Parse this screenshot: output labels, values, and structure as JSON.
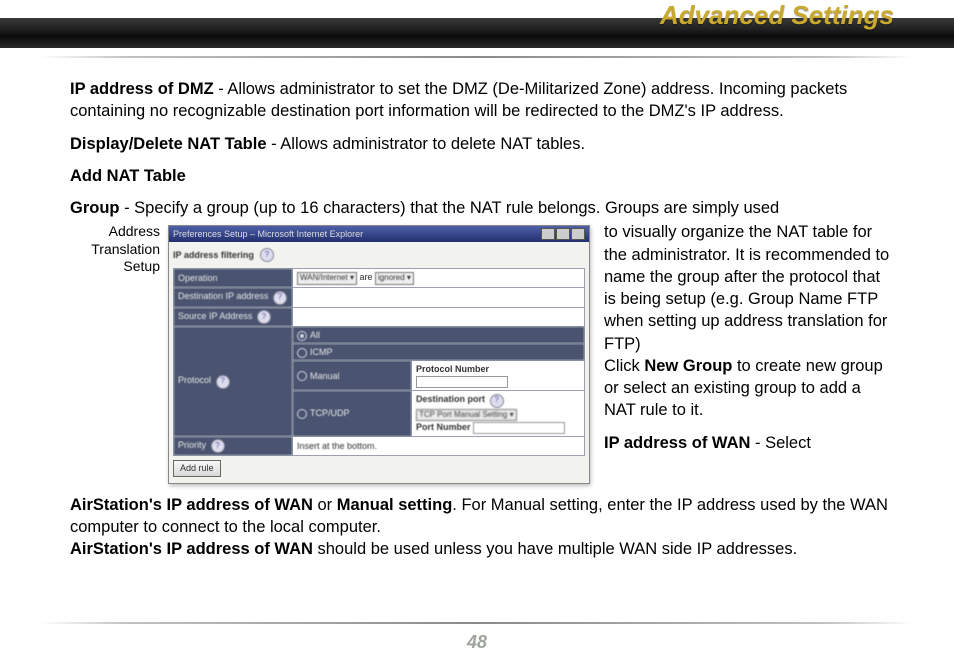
{
  "header": {
    "title": "Advanced Settings"
  },
  "pagenum": "48",
  "para": {
    "dmz_label": "IP address of DMZ",
    "dmz_text": " - Allows administrator to set the DMZ (De-Militarized Zone) address. Incoming packets containing no recognizable destination port information will be redirected to the DMZ's IP address.",
    "nat_del_label": "Display/Delete NAT Table",
    "nat_del_text": "  - Allows administrator to delete NAT tables.",
    "add_nat_label": "Add NAT Table",
    "group_label": "Group",
    "group_lead_text": " - Specify a group (up to 16 characters) that the NAT rule belongs.   Groups are simply used ",
    "group_wrap_text_1": "to visually organize the NAT table for the administrator.  It is recommended to name the group after the protocol that is being setup (e.g. Group Name FTP when setting up address translation for FTP)",
    "group_wrap_click": "Click ",
    "group_wrap_newgroup": "New Group",
    "group_wrap_text_2": " to create new group or select an existing group to add a NAT rule to it.",
    "wan_label": "IP address of WAN",
    "wan_tail": " - Select ",
    "wan_para_1a": "AirStation's IP address of WAN",
    "wan_para_1b": " or ",
    "wan_para_1c": "Manual setting",
    "wan_para_1d": ".  For Manual setting, enter the IP address used by the WAN computer to connect to the local computer.",
    "wan_para_2a": "AirStation's IP address of WAN",
    "wan_para_2b": " should be used unless you have multiple WAN side IP addresses."
  },
  "caption": {
    "l1": "Address",
    "l2": "Translation",
    "l3": "Setup"
  },
  "shot": {
    "title": "Preferences Setup – Microsoft Internet Explorer",
    "ip_filter": "IP address filtering",
    "row_operation": "Operation",
    "row_dst": "Destination IP address",
    "row_src": "Source IP Address",
    "row_protocol": "Protocol",
    "row_priority": "Priority",
    "op_sel1": "WAN/Internet ▾",
    "op_sel2": "are",
    "op_sel3": "ignored   ▾",
    "proto_all": "All",
    "proto_icmp": "ICMP",
    "proto_manual": "Manual",
    "proto_tcpudp": "TCP/UDP",
    "proto_num_label": "Protocol Number",
    "dstport_label": "Destination port",
    "dstport_sel": "TCP Port Manual Setting ▾",
    "portnum_label": "Port Number",
    "priority_text": "Insert at the bottom.",
    "add_btn": "Add rule"
  }
}
